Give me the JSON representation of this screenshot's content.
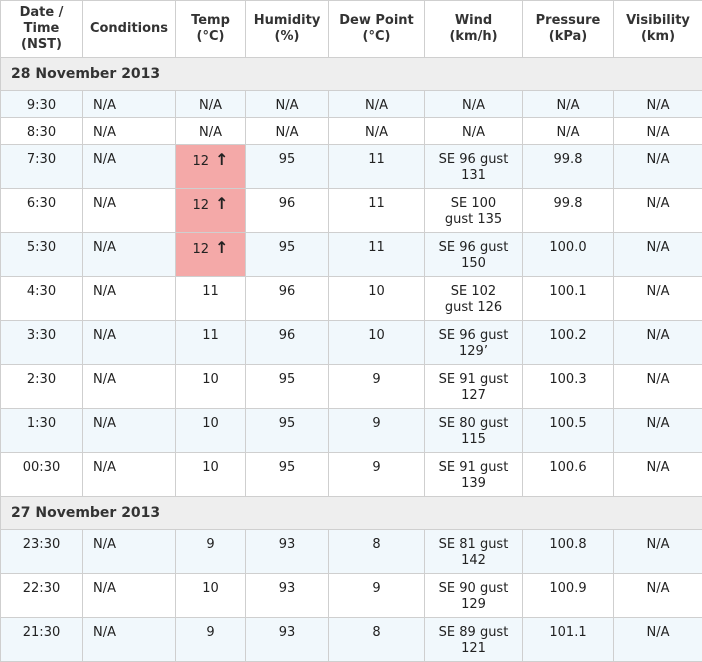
{
  "headers": {
    "date_time_line1": "Date /",
    "date_time_line2": "Time",
    "date_time_line3": "(NST)",
    "conditions": "Conditions",
    "temp_line1": "Temp",
    "temp_line2": "(°C)",
    "humidity_line1": "Humidity",
    "humidity_line2": "(%)",
    "dew_line1": "Dew Point",
    "dew_line2": "(°C)",
    "wind_line1": "Wind",
    "wind_line2": "(km/h)",
    "pressure_line1": "Pressure",
    "pressure_line2": "(kPa)",
    "visibility_line1": "Visibility",
    "visibility_line2": "(km)"
  },
  "groups": [
    {
      "date": "28 November 2013",
      "rows": [
        {
          "time": "9:30",
          "conditions": "N/A",
          "temp": "N/A",
          "humidity": "N/A",
          "dew": "N/A",
          "wind1": "N/A",
          "wind2": "",
          "pressure": "N/A",
          "visibility": "N/A"
        },
        {
          "time": "8:30",
          "conditions": "N/A",
          "temp": "N/A",
          "humidity": "N/A",
          "dew": "N/A",
          "wind1": "N/A",
          "wind2": "",
          "pressure": "N/A",
          "visibility": "N/A"
        },
        {
          "time": "7:30",
          "conditions": "N/A",
          "temp": "12",
          "temp_arrow": "↑",
          "humidity": "95",
          "dew": "11",
          "wind1": "SE 96 gust",
          "wind2": "131",
          "pressure": "99.8",
          "visibility": "N/A"
        },
        {
          "time": "6:30",
          "conditions": "N/A",
          "temp": "12",
          "temp_arrow": "↑",
          "humidity": "96",
          "dew": "11",
          "wind1": "SE 100",
          "wind2": "gust 135",
          "pressure": "99.8",
          "visibility": "N/A"
        },
        {
          "time": "5:30",
          "conditions": "N/A",
          "temp": "12",
          "temp_arrow": "↑",
          "humidity": "95",
          "dew": "11",
          "wind1": "SE 96 gust",
          "wind2": "150",
          "pressure": "100.0",
          "visibility": "N/A"
        },
        {
          "time": "4:30",
          "conditions": "N/A",
          "temp": "11",
          "humidity": "96",
          "dew": "10",
          "wind1": "SE 102",
          "wind2": "gust 126",
          "pressure": "100.1",
          "visibility": "N/A"
        },
        {
          "time": "3:30",
          "conditions": "N/A",
          "temp": "11",
          "humidity": "96",
          "dew": "10",
          "wind1": "SE 96 gust",
          "wind2": "129’",
          "pressure": "100.2",
          "visibility": "N/A"
        },
        {
          "time": "2:30",
          "conditions": "N/A",
          "temp": "10",
          "humidity": "95",
          "dew": "9",
          "wind1": "SE 91 gust",
          "wind2": "127",
          "pressure": "100.3",
          "visibility": "N/A"
        },
        {
          "time": "1:30",
          "conditions": "N/A",
          "temp": "10",
          "humidity": "95",
          "dew": "9",
          "wind1": "SE 80 gust",
          "wind2": "115",
          "pressure": "100.5",
          "visibility": "N/A"
        },
        {
          "time": "00:30",
          "conditions": "N/A",
          "temp": "10",
          "humidity": "95",
          "dew": "9",
          "wind1": "SE 91 gust",
          "wind2": "139",
          "pressure": "100.6",
          "visibility": "N/A"
        }
      ]
    },
    {
      "date": "27 November 2013",
      "rows": [
        {
          "time": "23:30",
          "conditions": "N/A",
          "temp": "9",
          "humidity": "93",
          "dew": "8",
          "wind1": "SE 81 gust",
          "wind2": "142",
          "pressure": "100.8",
          "visibility": "N/A"
        },
        {
          "time": "22:30",
          "conditions": "N/A",
          "temp": "10",
          "humidity": "93",
          "dew": "9",
          "wind1": "SE 90 gust",
          "wind2": "129",
          "pressure": "100.9",
          "visibility": "N/A"
        },
        {
          "time": "21:30",
          "conditions": "N/A",
          "temp": "9",
          "humidity": "93",
          "dew": "8",
          "wind1": "SE 89 gust",
          "wind2": "121",
          "pressure": "101.1",
          "visibility": "N/A"
        }
      ]
    }
  ]
}
